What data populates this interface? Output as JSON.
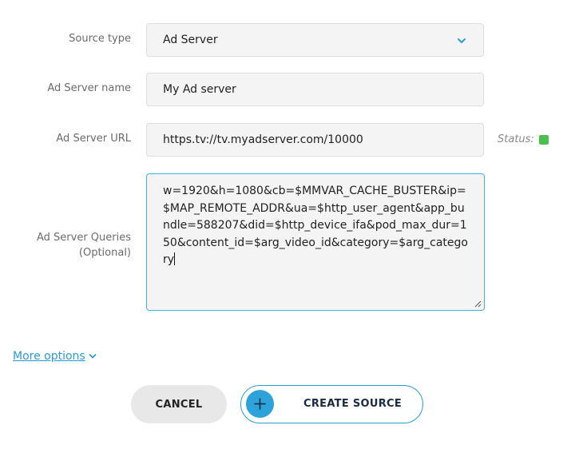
{
  "form": {
    "source_type": {
      "label": "Source type",
      "value": "Ad Server",
      "icon": "chevron-down-icon"
    },
    "ad_server_name": {
      "label": "Ad Server name",
      "value": "My Ad server"
    },
    "ad_server_url": {
      "label": "Ad Server URL",
      "value": "https.tv://tv.myadserver.com/10000",
      "status_label": "Status:",
      "status_color": "#4cc04f"
    },
    "ad_server_queries": {
      "label_line1": "Ad Server Queries",
      "label_line2": "(Optional)",
      "value": "w=1920&h=1080&cb=$MMVAR_CACHE_BUSTER&ip=$MAP_REMOTE_ADDR&ua=$http_user_agent&app_bundle=588207&did=$http_device_ifa&pod_max_dur=150&content_id=$arg_video_id&category=$arg_category"
    }
  },
  "more_options": {
    "label": "More options",
    "icon": "chevron-down-icon"
  },
  "actions": {
    "cancel_label": "CANCEL",
    "create_label": "CREATE SOURCE",
    "create_icon": "plus-icon"
  },
  "colors": {
    "accent": "#2a9bd6",
    "focus_border": "#3fb3e6",
    "field_bg": "#f4f4f4"
  }
}
